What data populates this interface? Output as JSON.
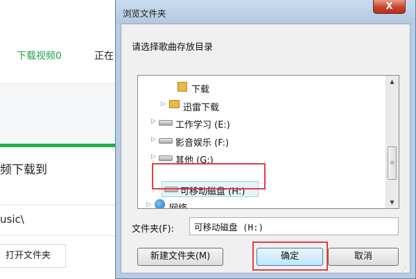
{
  "background_app": {
    "tabs": {
      "active": "下载视频0",
      "next": "正在"
    },
    "section_title": "频下载到",
    "path": "usic\\",
    "open_folder_button": "打开文件夹",
    "accent_color": "#1fb14b"
  },
  "dialog": {
    "title": "浏览文件夹",
    "close_label": "X",
    "prompt": "请选择歌曲存放目录",
    "tree": [
      {
        "label": "下载",
        "icon": "download-folder-icon"
      },
      {
        "label": "迅雷下载",
        "icon": "folder-icon"
      },
      {
        "label": "工作学习 (E:)",
        "icon": "drive-icon"
      },
      {
        "label": "影音娱乐 (F:)",
        "icon": "drive-icon"
      },
      {
        "label": "其他 (G:)",
        "icon": "drive-icon"
      },
      {
        "label": "可移动磁盘 (H:)",
        "icon": "removable-drive-icon",
        "selected": true
      },
      {
        "label": "网络",
        "icon": "network-icon"
      }
    ],
    "folder_label": "文件夹(F):",
    "folder_value": "可移动磁盘 (H:)",
    "buttons": {
      "new_folder": "新建文件夹(M)",
      "ok": "确定",
      "cancel": "取消"
    },
    "highlight_color": "#e33b3b"
  }
}
